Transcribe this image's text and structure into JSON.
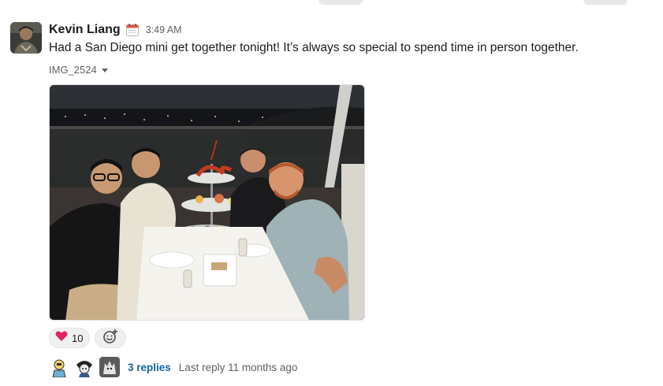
{
  "message": {
    "sender": "Kevin Liang",
    "status_emoji": "calendar-icon",
    "timestamp": "3:49 AM",
    "text": "Had a San Diego mini get together tonight! It’s always so special to spend time in person together.",
    "attachment": {
      "name": "IMG_2524",
      "toggle_icon": "caret-down-icon"
    }
  },
  "reactions": [
    {
      "emoji": "heart-icon",
      "count": "10"
    }
  ],
  "add_reaction_icon": "add-emoji-icon",
  "thread": {
    "replies_label": "3 replies",
    "last_reply": "Last reply 11 months ago"
  },
  "colors": {
    "link": "#1264a3",
    "muted": "#616061",
    "text": "#1d1c1d",
    "heart": "#e0245e"
  }
}
